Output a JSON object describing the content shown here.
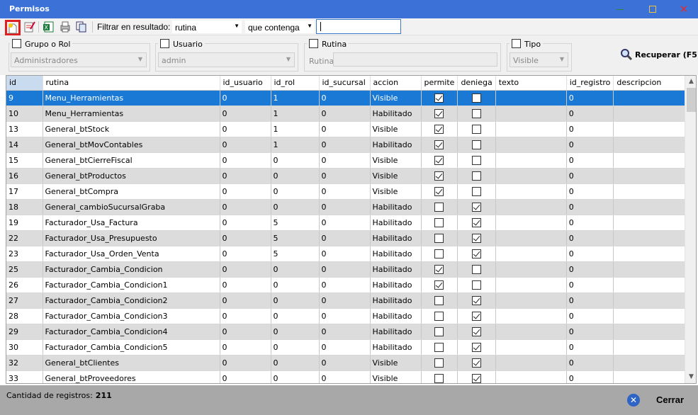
{
  "window": {
    "title": "Permisos",
    "minimize_icon": "minimize-icon",
    "maximize_icon": "maximize-icon",
    "close_icon": "close-icon"
  },
  "toolbar": {
    "icons": [
      "new-record-icon",
      "edit-icon",
      "excel-export-icon",
      "print-preview-icon",
      "copy-icon"
    ],
    "filter_label": "Filtrar en resultado:",
    "filter_field": "rutina",
    "filter_op": "que contenga",
    "filter_value": ""
  },
  "filters": {
    "grupo": {
      "label": "Grupo o Rol",
      "value": "Administradores",
      "checked": false
    },
    "usuario": {
      "label": "Usuario",
      "value": "admin",
      "checked": false
    },
    "rutina": {
      "label": "Rutina",
      "field_label": "Rutina",
      "value": "",
      "checked": false
    },
    "tipo": {
      "label": "Tipo",
      "value": "Visible",
      "checked": false
    },
    "recuperar": "Recuperar (F5)"
  },
  "grid": {
    "columns": [
      "id",
      "rutina",
      "id_usuario",
      "id_rol",
      "id_sucursal",
      "accion",
      "permite",
      "deniega",
      "texto",
      "id_registro",
      "descripcion"
    ],
    "rows": [
      {
        "id": "9",
        "rutina": "Menu_Herramientas",
        "id_usuario": "0",
        "id_rol": "1",
        "id_sucursal": "0",
        "accion": "Visible",
        "permite": true,
        "deniega": false,
        "texto": "",
        "id_registro": "0",
        "descripcion": ""
      },
      {
        "id": "10",
        "rutina": "Menu_Herramientas",
        "id_usuario": "0",
        "id_rol": "1",
        "id_sucursal": "0",
        "accion": "Habilitado",
        "permite": true,
        "deniega": false,
        "texto": "",
        "id_registro": "0",
        "descripcion": ""
      },
      {
        "id": "13",
        "rutina": "General_btStock",
        "id_usuario": "0",
        "id_rol": "1",
        "id_sucursal": "0",
        "accion": "Visible",
        "permite": true,
        "deniega": false,
        "texto": "",
        "id_registro": "0",
        "descripcion": ""
      },
      {
        "id": "14",
        "rutina": "General_btMovContables",
        "id_usuario": "0",
        "id_rol": "1",
        "id_sucursal": "0",
        "accion": "Habilitado",
        "permite": true,
        "deniega": false,
        "texto": "",
        "id_registro": "0",
        "descripcion": ""
      },
      {
        "id": "15",
        "rutina": "General_btCierreFiscal",
        "id_usuario": "0",
        "id_rol": "0",
        "id_sucursal": "0",
        "accion": "Visible",
        "permite": true,
        "deniega": false,
        "texto": "",
        "id_registro": "0",
        "descripcion": ""
      },
      {
        "id": "16",
        "rutina": "General_btProductos",
        "id_usuario": "0",
        "id_rol": "0",
        "id_sucursal": "0",
        "accion": "Visible",
        "permite": true,
        "deniega": false,
        "texto": "",
        "id_registro": "0",
        "descripcion": ""
      },
      {
        "id": "17",
        "rutina": "General_btCompra",
        "id_usuario": "0",
        "id_rol": "0",
        "id_sucursal": "0",
        "accion": "Visible",
        "permite": true,
        "deniega": false,
        "texto": "",
        "id_registro": "0",
        "descripcion": ""
      },
      {
        "id": "18",
        "rutina": "General_cambioSucursalGraba",
        "id_usuario": "0",
        "id_rol": "0",
        "id_sucursal": "0",
        "accion": "Habilitado",
        "permite": false,
        "deniega": true,
        "texto": "",
        "id_registro": "0",
        "descripcion": ""
      },
      {
        "id": "19",
        "rutina": "Facturador_Usa_Factura",
        "id_usuario": "0",
        "id_rol": "5",
        "id_sucursal": "0",
        "accion": "Habilitado",
        "permite": false,
        "deniega": true,
        "texto": "",
        "id_registro": "0",
        "descripcion": ""
      },
      {
        "id": "22",
        "rutina": "Facturador_Usa_Presupuesto",
        "id_usuario": "0",
        "id_rol": "5",
        "id_sucursal": "0",
        "accion": "Habilitado",
        "permite": false,
        "deniega": true,
        "texto": "",
        "id_registro": "0",
        "descripcion": ""
      },
      {
        "id": "23",
        "rutina": "Facturador_Usa_Orden_Venta",
        "id_usuario": "0",
        "id_rol": "5",
        "id_sucursal": "0",
        "accion": "Habilitado",
        "permite": false,
        "deniega": true,
        "texto": "",
        "id_registro": "0",
        "descripcion": ""
      },
      {
        "id": "25",
        "rutina": "Facturador_Cambia_Condicion",
        "id_usuario": "0",
        "id_rol": "0",
        "id_sucursal": "0",
        "accion": "Habilitado",
        "permite": true,
        "deniega": false,
        "texto": "",
        "id_registro": "0",
        "descripcion": ""
      },
      {
        "id": "26",
        "rutina": "Facturador_Cambia_Condicion1",
        "id_usuario": "0",
        "id_rol": "0",
        "id_sucursal": "0",
        "accion": "Habilitado",
        "permite": true,
        "deniega": false,
        "texto": "",
        "id_registro": "0",
        "descripcion": ""
      },
      {
        "id": "27",
        "rutina": "Facturador_Cambia_Condicion2",
        "id_usuario": "0",
        "id_rol": "0",
        "id_sucursal": "0",
        "accion": "Habilitado",
        "permite": false,
        "deniega": true,
        "texto": "",
        "id_registro": "0",
        "descripcion": ""
      },
      {
        "id": "28",
        "rutina": "Facturador_Cambia_Condicion3",
        "id_usuario": "0",
        "id_rol": "0",
        "id_sucursal": "0",
        "accion": "Habilitado",
        "permite": false,
        "deniega": true,
        "texto": "",
        "id_registro": "0",
        "descripcion": ""
      },
      {
        "id": "29",
        "rutina": "Facturador_Cambia_Condicion4",
        "id_usuario": "0",
        "id_rol": "0",
        "id_sucursal": "0",
        "accion": "Habilitado",
        "permite": false,
        "deniega": true,
        "texto": "",
        "id_registro": "0",
        "descripcion": ""
      },
      {
        "id": "30",
        "rutina": "Facturador_Cambia_Condicion5",
        "id_usuario": "0",
        "id_rol": "0",
        "id_sucursal": "0",
        "accion": "Habilitado",
        "permite": false,
        "deniega": true,
        "texto": "",
        "id_registro": "0",
        "descripcion": ""
      },
      {
        "id": "32",
        "rutina": "General_btClientes",
        "id_usuario": "0",
        "id_rol": "0",
        "id_sucursal": "0",
        "accion": "Visible",
        "permite": false,
        "deniega": true,
        "texto": "",
        "id_registro": "0",
        "descripcion": ""
      },
      {
        "id": "33",
        "rutina": "General_btProveedores",
        "id_usuario": "0",
        "id_rol": "0",
        "id_sucursal": "0",
        "accion": "Visible",
        "permite": false,
        "deniega": true,
        "texto": "",
        "id_registro": "0",
        "descripcion": ""
      }
    ],
    "selected_row": 0
  },
  "footer": {
    "count_label": "Cantidad de registros:",
    "count_value": "211",
    "close_label": "Cerrar",
    "close_icon": "close-circle-icon"
  },
  "colors": {
    "titlebar": "#3c72d8",
    "selection": "#1979d4",
    "alt_row": "#dcdcdc",
    "footer": "#a8a8a8",
    "highlight_box": "#e02020"
  }
}
